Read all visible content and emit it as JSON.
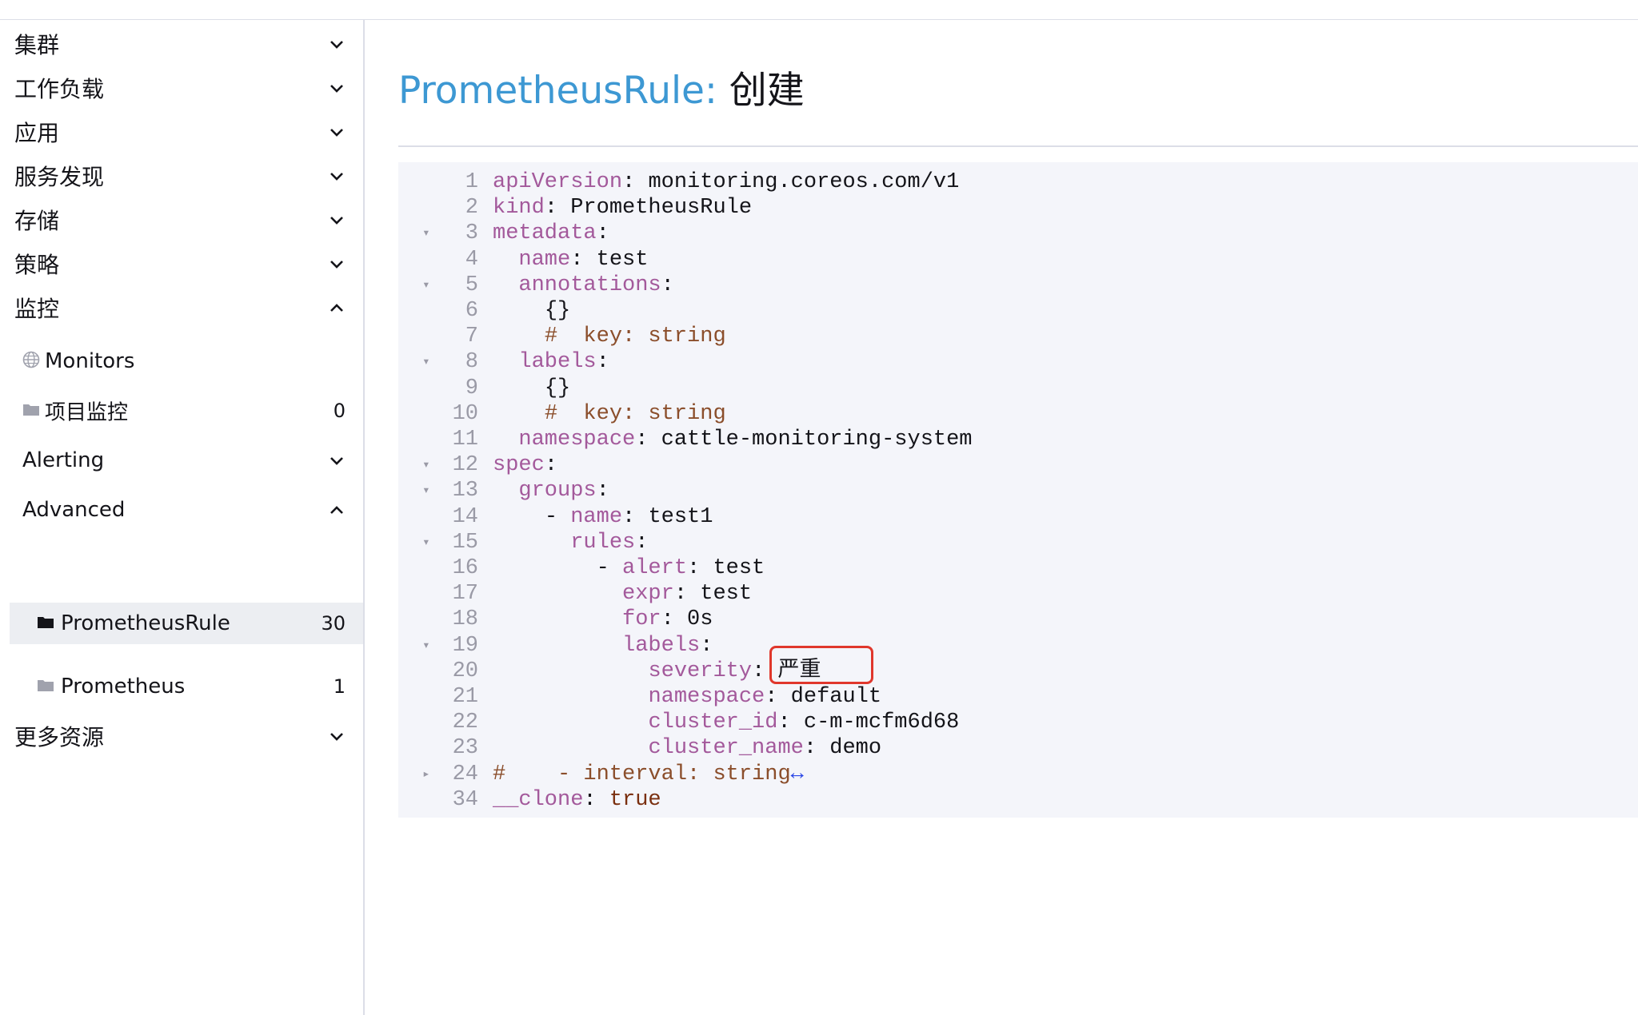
{
  "sidebar": {
    "groups": [
      {
        "label": "集群",
        "state": "collapsed"
      },
      {
        "label": "工作负载",
        "state": "collapsed"
      },
      {
        "label": "应用",
        "state": "collapsed"
      },
      {
        "label": "服务发现",
        "state": "collapsed"
      },
      {
        "label": "存储",
        "state": "collapsed"
      },
      {
        "label": "策略",
        "state": "collapsed"
      },
      {
        "label": "监控",
        "state": "expanded"
      },
      {
        "label": "更多资源",
        "state": "collapsed"
      }
    ],
    "monitoring": {
      "monitors_label": "Monitors",
      "project_monitors_label": "项目监控",
      "project_monitors_count": "0",
      "alerting_label": "Alerting",
      "advanced_label": "Advanced",
      "prometheus_rule_label": "PrometheusRule",
      "prometheus_rule_count": "30",
      "prometheus_label": "Prometheus",
      "prometheus_count": "1"
    }
  },
  "header": {
    "resource_type": "PrometheusRule:",
    "action": "创建"
  },
  "editor": {
    "lines": [
      {
        "num": "1",
        "fold": "",
        "key": "apiVersion",
        "sep": ": ",
        "val": "monitoring.coreos.com/v1",
        "indent": ""
      },
      {
        "num": "2",
        "fold": "",
        "key": "kind",
        "sep": ": ",
        "val": "PrometheusRule",
        "indent": ""
      },
      {
        "num": "3",
        "fold": "▾",
        "key": "metadata",
        "sep": ":",
        "val": "",
        "indent": ""
      },
      {
        "num": "4",
        "fold": "",
        "key": "name",
        "sep": ": ",
        "val": "test",
        "indent": "  "
      },
      {
        "num": "5",
        "fold": "▾",
        "key": "annotations",
        "sep": ":",
        "val": "",
        "indent": "  "
      },
      {
        "num": "6",
        "fold": "",
        "key": "",
        "sep": "",
        "val": "{}",
        "indent": "    "
      },
      {
        "num": "7",
        "fold": "",
        "comment": "#  key: string",
        "indent": "    "
      },
      {
        "num": "8",
        "fold": "▾",
        "key": "labels",
        "sep": ":",
        "val": "",
        "indent": "  "
      },
      {
        "num": "9",
        "fold": "",
        "key": "",
        "sep": "",
        "val": "{}",
        "indent": "    "
      },
      {
        "num": "10",
        "fold": "",
        "comment": "#  key: string",
        "indent": "    "
      },
      {
        "num": "11",
        "fold": "",
        "key": "namespace",
        "sep": ": ",
        "val": "cattle-monitoring-system",
        "indent": "  "
      },
      {
        "num": "12",
        "fold": "▾",
        "key": "spec",
        "sep": ":",
        "val": "",
        "indent": ""
      },
      {
        "num": "13",
        "fold": "▾",
        "key": "groups",
        "sep": ":",
        "val": "",
        "indent": "  "
      },
      {
        "num": "14",
        "fold": "",
        "dash": "- ",
        "key": "name",
        "sep": ": ",
        "val": "test1",
        "indent": "    "
      },
      {
        "num": "15",
        "fold": "▾",
        "key": "rules",
        "sep": ":",
        "val": "",
        "indent": "      "
      },
      {
        "num": "16",
        "fold": "",
        "dash": "- ",
        "key": "alert",
        "sep": ": ",
        "val": "test",
        "indent": "        "
      },
      {
        "num": "17",
        "fold": "",
        "key": "expr",
        "sep": ": ",
        "val": "test",
        "indent": "          "
      },
      {
        "num": "18",
        "fold": "",
        "key": "for",
        "sep": ": ",
        "val": "0s",
        "indent": "          "
      },
      {
        "num": "19",
        "fold": "▾",
        "key": "labels",
        "sep": ":",
        "val": "",
        "indent": "          "
      },
      {
        "num": "20",
        "fold": "",
        "key": "severity",
        "sep": ": ",
        "val": "严重",
        "indent": "            "
      },
      {
        "num": "21",
        "fold": "",
        "key": "namespace",
        "sep": ": ",
        "val": "default",
        "indent": "            "
      },
      {
        "num": "22",
        "fold": "",
        "key": "cluster_id",
        "sep": ": ",
        "val": "c-m-mcfm6d68",
        "indent": "            "
      },
      {
        "num": "23",
        "fold": "",
        "key": "cluster_name",
        "sep": ": ",
        "val": "demo",
        "indent": "            "
      },
      {
        "num": "24",
        "fold": "▸",
        "comment": "#    - interval: string",
        "marker": "↔",
        "indent": ""
      },
      {
        "num": "34",
        "fold": "",
        "key": "__clone",
        "sep": ": ",
        "val": "true",
        "valKeyword": true,
        "indent": ""
      }
    ]
  },
  "colors": {
    "title_accent": "#3d98d3",
    "yaml_key": "#a3599b",
    "yaml_comment": "#8b4e2b",
    "highlight_box": "#e0372c"
  }
}
